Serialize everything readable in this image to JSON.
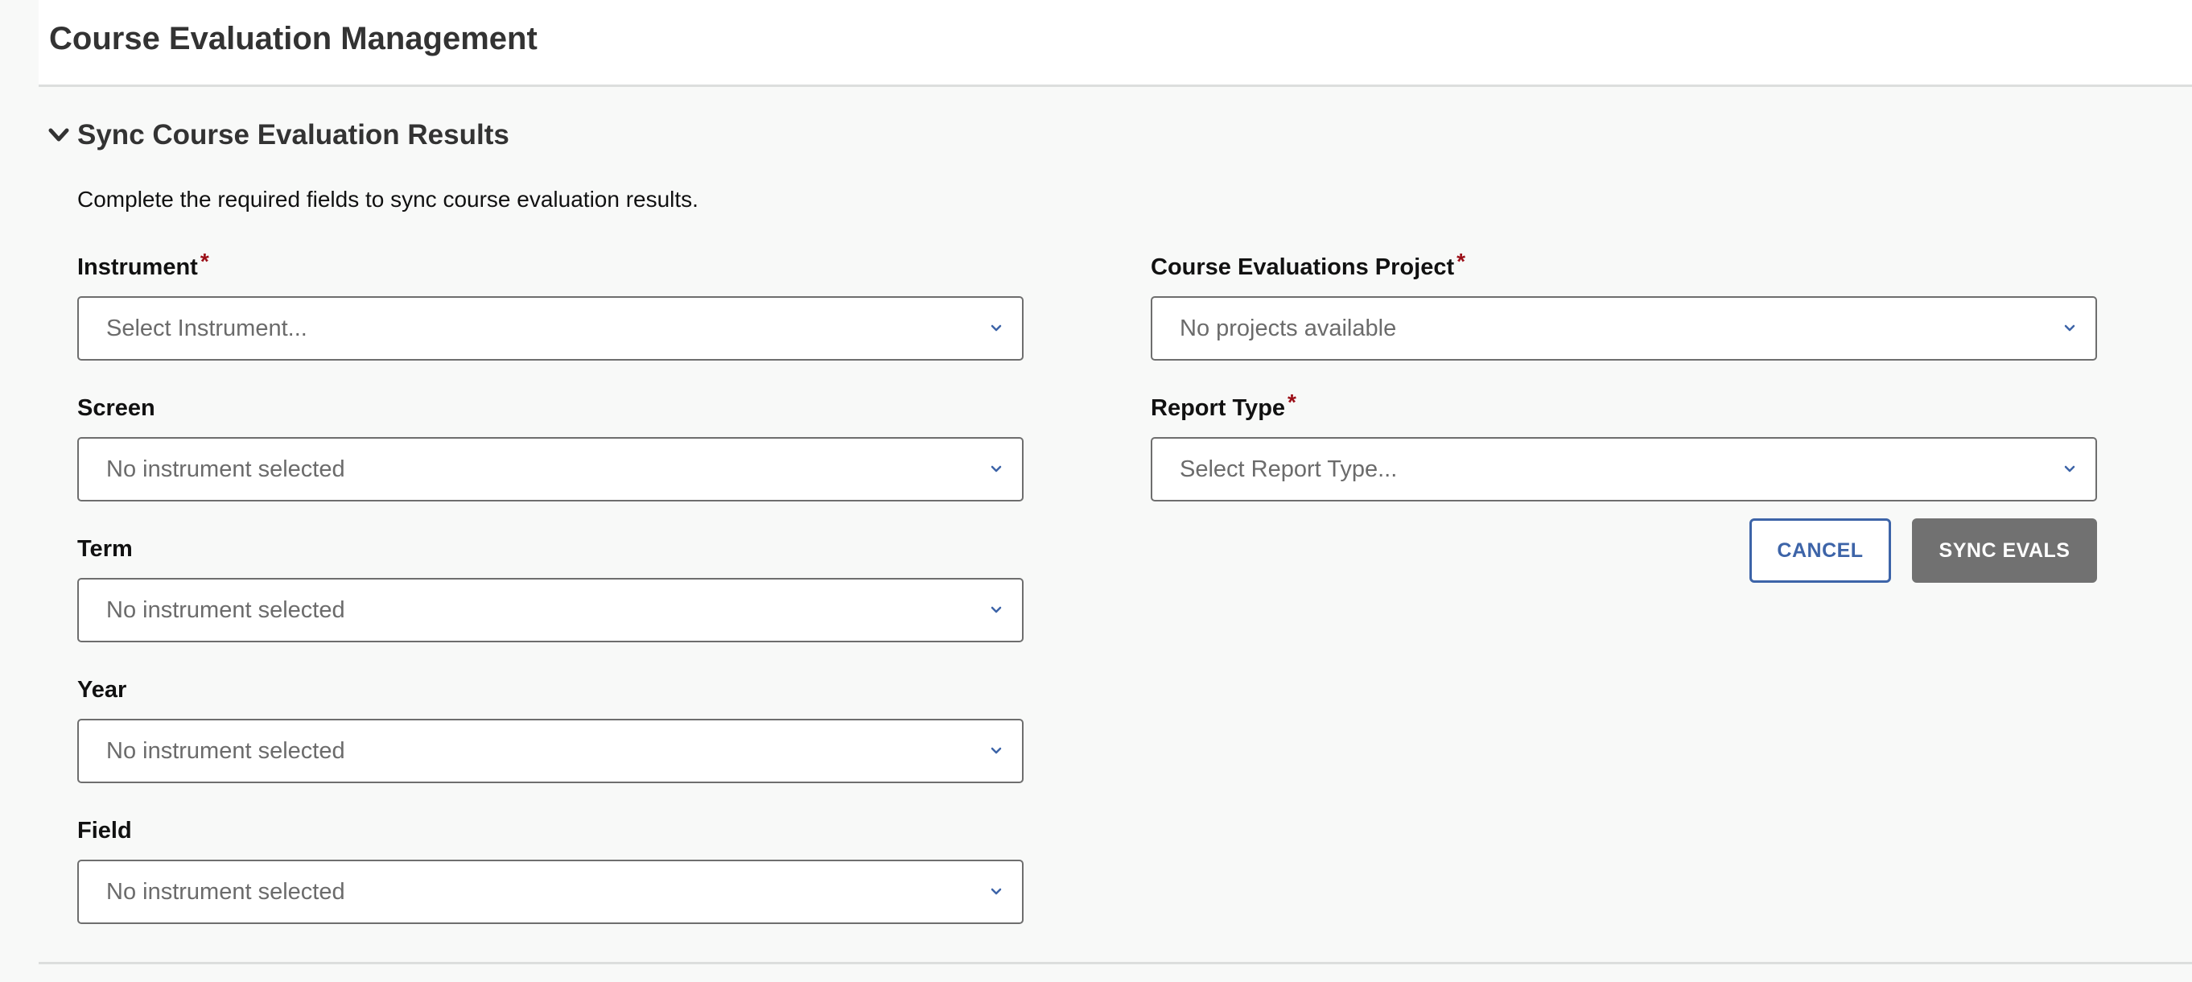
{
  "header": {
    "title": "Course Evaluation Management"
  },
  "section": {
    "title": "Sync Course Evaluation Results",
    "instructions": "Complete the required fields to sync course evaluation results.",
    "toggle_icon": "chevron-down-icon"
  },
  "form": {
    "left_fields": [
      {
        "label": "Instrument",
        "required": true,
        "value": "Select Instrument..."
      },
      {
        "label": "Screen",
        "required": false,
        "value": "No instrument selected"
      },
      {
        "label": "Term",
        "required": false,
        "value": "No instrument selected"
      },
      {
        "label": "Year",
        "required": false,
        "value": "No instrument selected"
      },
      {
        "label": "Field",
        "required": false,
        "value": "No instrument selected"
      }
    ],
    "right_fields": [
      {
        "label": "Course Evaluations Project",
        "required": true,
        "value": "No projects available"
      },
      {
        "label": "Report Type",
        "required": true,
        "value": "Select Report Type..."
      }
    ],
    "required_marker": "*"
  },
  "actions": {
    "cancel_label": "CANCEL",
    "sync_label": "SYNC EVALS"
  },
  "colors": {
    "accent": "#3d64a8",
    "required": "#9b0e17",
    "disabled_button": "#717171",
    "background": "#f8f9f8"
  }
}
